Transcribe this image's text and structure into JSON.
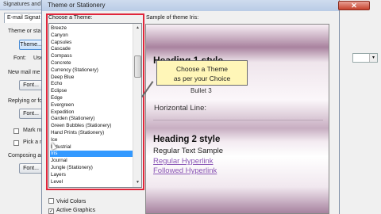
{
  "background_window": {
    "title": "Signatures and",
    "tab_email_signature": "E-mail Signat",
    "theme_or_stationery_label": "Theme or sta",
    "theme_button": "Theme...",
    "font_label": "Font:",
    "font_value": "Use",
    "new_mail_label": "New mail me",
    "font_button_1": "Font...",
    "replying_label": "Replying or fo",
    "font_button_2": "Font...",
    "mark_my_label": "Mark my",
    "pick_new_label": "Pick a n",
    "composing_label": "Composing an",
    "font_button_3": "Font...",
    "combo_arrow": "▾"
  },
  "dialog": {
    "title": "Theme or Stationery",
    "close_glyph": "✕",
    "choose_label": "Choose a Theme:",
    "themes": [
      "Breeze",
      "Canyon",
      "Capsules",
      "Cascade",
      "Compass",
      "Concrete",
      "Currency (Stationery)",
      "Deep Blue",
      "Echo",
      "Eclipse",
      "Edge",
      "Evergreen",
      "Expedition",
      "Garden (Stationery)",
      "Green Bubbles (Stationery)",
      "Hand Prints (Stationery)",
      "Ice",
      "Industrial",
      "Iris",
      "Journal",
      "Jungle (Stationery)",
      "Layers",
      "Level"
    ],
    "selected_theme": "Iris",
    "scroll_up": "▲",
    "scroll_down": "▼",
    "vivid_colors_label": "Vivid Colors",
    "vivid_colors_checked": false,
    "active_graphics_label": "Active Graphics",
    "active_graphics_checked": true,
    "check_glyph": "✓",
    "sample_label": "Sample of theme Iris:",
    "preview": {
      "heading1": "Heading 1 style",
      "bullet": "Bullet 3",
      "horizontal_line": "Horizontal Line:",
      "heading2": "Heading 2 style",
      "body": "Regular Text Sample",
      "link": "Regular Hyperlink",
      "followed_link": "Followed Hyperlink"
    },
    "callout_line1": "Choose a Theme",
    "callout_line2": "as per your Choice"
  },
  "colors": {
    "highlight_box": "#e0263b",
    "selection": "#3399ff",
    "callout_bg": "#fff6b8",
    "hyperlink": "#8a55b5"
  }
}
